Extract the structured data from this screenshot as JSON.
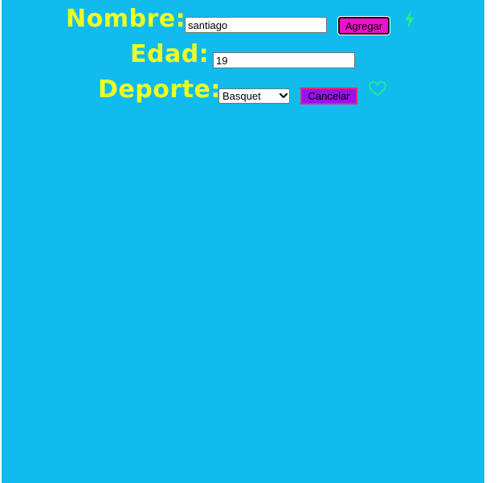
{
  "form": {
    "nombre": {
      "label": "Nombre:",
      "value": "santiago"
    },
    "edad": {
      "label": "Edad:",
      "value": "19"
    },
    "deporte": {
      "label": "Deporte:",
      "selected": "Basquet"
    },
    "buttons": {
      "agregar": "Agregar",
      "cancelar": "Cancelar"
    }
  },
  "icons": {
    "top": "lightning-bolt-icon",
    "bottom": "heart-outline-icon"
  },
  "colors": {
    "background": "#11bbee",
    "label": "#eeff22",
    "agregar_button": "#ee11cc",
    "cancelar_button": "#9911ee",
    "icon": "#22ee88"
  }
}
